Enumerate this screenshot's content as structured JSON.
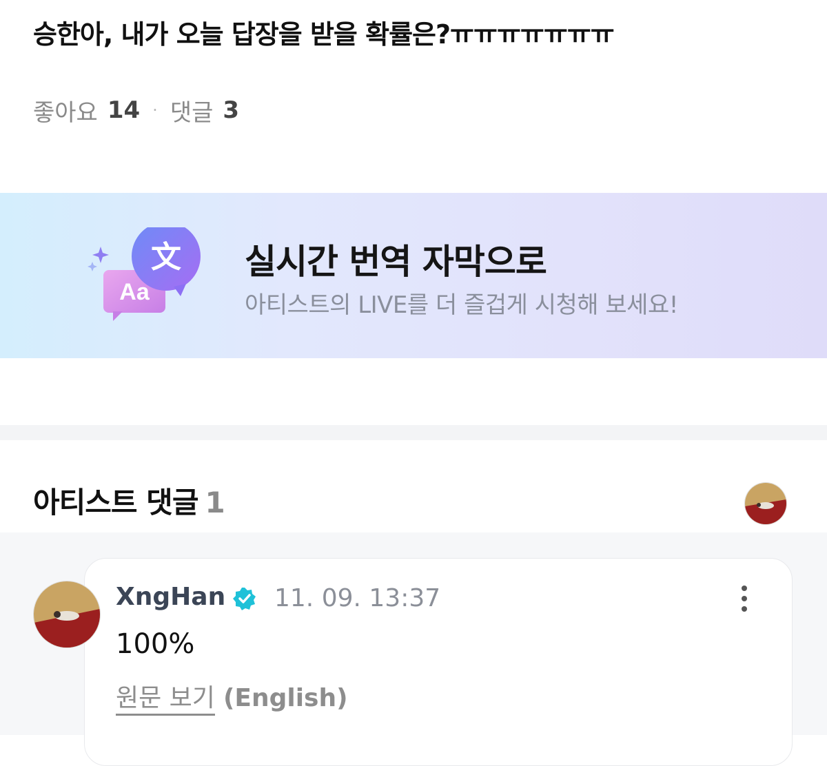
{
  "post": {
    "title": "승한아, 내가 오늘 답장을 받을 확률은?ㅠㅠㅠㅠㅠㅠㅠ",
    "likes_label": "좋아요",
    "likes_count": "14",
    "separator": "·",
    "comments_label": "댓글",
    "comments_count": "3"
  },
  "banner": {
    "title": "실시간 번역 자막으로",
    "subtitle": "아티스트의 LIVE를 더 즐겁게 시청해 보세요!",
    "icon_back_text": "Aa",
    "icon_front_text": "文"
  },
  "artist_comments": {
    "heading": "아티스트 댓글",
    "count": "1"
  },
  "comment": {
    "author": "XngHan",
    "timestamp": "11. 09. 13:37",
    "body": "100%",
    "view_original": "원문 보기",
    "language": "(English)"
  },
  "colors": {
    "verified": "#1fc1d8",
    "banner_bubble_purple": "#8f72f5",
    "banner_bubble_pink": "#d68ae8",
    "avatar_red": "#9b1f1f"
  }
}
